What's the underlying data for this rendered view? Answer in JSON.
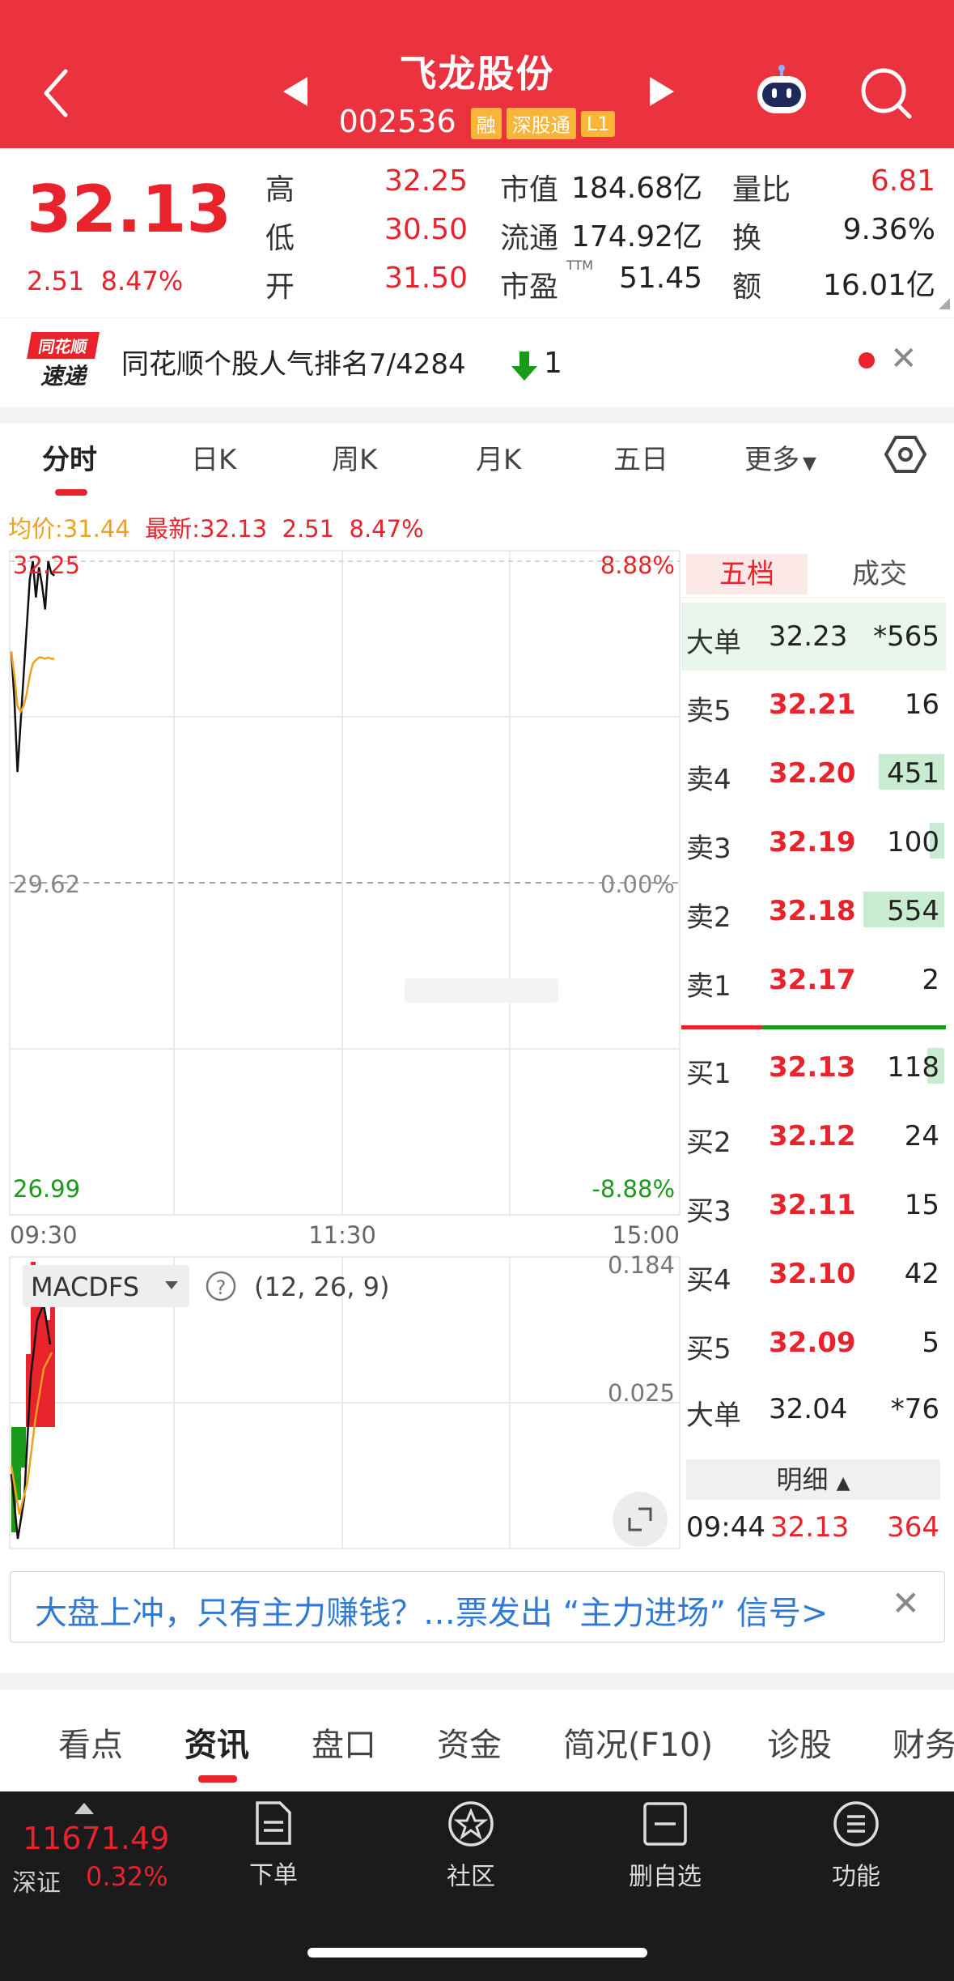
{
  "header": {
    "stock_name": "飞龙股份",
    "code": "002536",
    "tags": [
      "融",
      "深股通",
      "L1"
    ]
  },
  "quote": {
    "price": "32.13",
    "change": "2.51",
    "change_pct": "8.47%",
    "high_label": "高",
    "high": "32.25",
    "low_label": "低",
    "low": "30.50",
    "open_label": "开",
    "open": "31.50",
    "mcap_label": "市值",
    "mcap": "184.68亿",
    "float_label": "流通",
    "float": "174.92亿",
    "pe_label": "市盈",
    "pe_sup": "TTM",
    "pe": "51.45",
    "vr_label": "量比",
    "vr": "6.81",
    "turnover_label": "换",
    "turnover": "9.36%",
    "amount_label": "额",
    "amount": "16.01亿"
  },
  "notice": {
    "logo_top": "同花顺",
    "logo_bottom": "速递",
    "text": "同花顺个股人气排名7/4284",
    "change": "1"
  },
  "tabs": [
    "分时",
    "日K",
    "周K",
    "月K",
    "五日",
    "更多"
  ],
  "avg_line": {
    "avg_label": "均价:",
    "avg": "31.44",
    "latest_label": "最新:",
    "latest": "32.13",
    "chg": "2.51",
    "pct": "8.47%"
  },
  "chart": {
    "y_top": "32.25",
    "y_mid": "29.62",
    "y_bot": "26.99",
    "pct_top": "8.88%",
    "pct_mid": "0.00%",
    "pct_bot": "-8.88%",
    "time_start": "09:30",
    "time_mid": "11:30",
    "time_end": "15:00",
    "macd_name": "MACDFS",
    "macd_params": "(12, 26, 9)",
    "macd_top": "0.184",
    "macd_mid": "0.025"
  },
  "chart_data": {
    "type": "line",
    "x": [
      "09:30",
      "09:31",
      "09:32",
      "09:33",
      "09:34",
      "09:35",
      "09:36",
      "09:37",
      "09:38",
      "09:39",
      "09:40",
      "09:41",
      "09:42",
      "09:43",
      "09:44"
    ],
    "series": [
      {
        "values": [
          31.5,
          31.1,
          30.5,
          30.9,
          31.3,
          31.7,
          32.1,
          32.25,
          31.95,
          32.2,
          32.05,
          31.85,
          32.25,
          32.15,
          32.13
        ]
      },
      {
        "values": [
          31.5,
          31.3,
          31.05,
          31.0,
          31.05,
          31.15,
          31.3,
          31.4,
          31.43,
          31.45,
          31.45,
          31.44,
          31.45,
          31.44,
          31.44
        ]
      }
    ],
    "ylim": [
      26.99,
      32.25
    ]
  },
  "orderbook": {
    "tab_active": "五档",
    "tab_other": "成交",
    "big_sell": {
      "label": "大单",
      "price": "32.23",
      "vol": "*565"
    },
    "asks": [
      {
        "label": "卖5",
        "price": "32.21",
        "vol": "16",
        "bar": 0
      },
      {
        "label": "卖4",
        "price": "32.20",
        "vol": "451",
        "bar": 0.81
      },
      {
        "label": "卖3",
        "price": "32.19",
        "vol": "100",
        "bar": 0.18
      },
      {
        "label": "卖2",
        "price": "32.18",
        "vol": "554",
        "bar": 1.0
      },
      {
        "label": "卖1",
        "price": "32.17",
        "vol": "2",
        "bar": 0
      }
    ],
    "bids": [
      {
        "label": "买1",
        "price": "32.13",
        "vol": "118",
        "bar": 0.21
      },
      {
        "label": "买2",
        "price": "32.12",
        "vol": "24",
        "bar": 0
      },
      {
        "label": "买3",
        "price": "32.11",
        "vol": "15",
        "bar": 0
      },
      {
        "label": "买4",
        "price": "32.10",
        "vol": "42",
        "bar": 0
      },
      {
        "label": "买5",
        "price": "32.09",
        "vol": "5",
        "bar": 0
      }
    ],
    "big_buy": {
      "label": "大单",
      "price": "32.04",
      "vol": "*76"
    },
    "detail_label": "明细",
    "last_trade": {
      "time": "09:44",
      "price": "32.13",
      "vol": "364"
    }
  },
  "banner": {
    "text": "大盘上冲，只有主力赚钱？…票发出 “主力进场” 信号>"
  },
  "bottom_tabs": [
    "看点",
    "资讯",
    "盘口",
    "资金",
    "简况(F10)",
    "诊股",
    "财务"
  ],
  "footer": {
    "index_value": "11671.49",
    "index_name": "深证",
    "index_pct": "0.32%",
    "buttons": [
      "下单",
      "社区",
      "删自选",
      "功能"
    ]
  },
  "colors": {
    "header": "#eb3340",
    "up": "#e8232c",
    "down": "#1a9a1a",
    "avg_line": "#f0a020",
    "link": "#2f7ad6"
  }
}
